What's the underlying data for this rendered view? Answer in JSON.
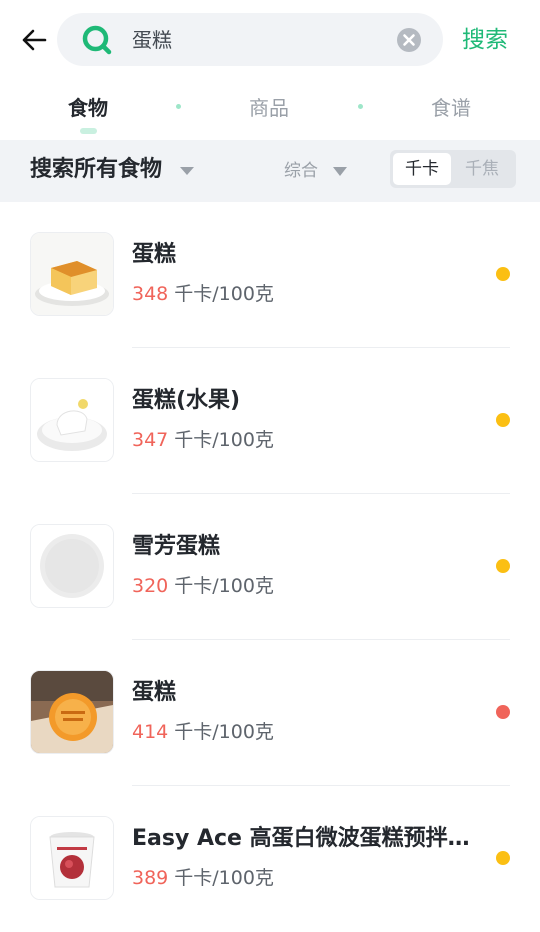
{
  "search": {
    "query": "蛋糕",
    "button_label": "搜索"
  },
  "tabs": [
    {
      "label": "食物",
      "active": true
    },
    {
      "label": "商品",
      "active": false
    },
    {
      "label": "食谱",
      "active": false
    }
  ],
  "filter": {
    "title": "搜索所有食物",
    "sort_label": "综合",
    "unit_options": [
      "千卡",
      "千焦"
    ],
    "selected_unit": "千卡"
  },
  "colors": {
    "accent": "#1fb977",
    "calorie": "#f0645a",
    "dot_medium": "#fbbf13",
    "dot_high": "#f0645a"
  },
  "foods": [
    {
      "name": "蛋糕",
      "calories": "348",
      "unit": "千卡/100克",
      "dot_color": "#fbbf13",
      "image": "sponge-cake"
    },
    {
      "name": "蛋糕(水果)",
      "calories": "347",
      "unit": "千卡/100克",
      "dot_color": "#fbbf13",
      "image": "fruit-cake"
    },
    {
      "name": "雪芳蛋糕",
      "calories": "320",
      "unit": "千卡/100克",
      "dot_color": "#fbbf13",
      "image": "placeholder"
    },
    {
      "name": "蛋糕",
      "calories": "414",
      "unit": "千卡/100克",
      "dot_color": "#f0645a",
      "image": "packaged-cake"
    },
    {
      "name": "Easy Ace 高蛋白微波蛋糕预拌…",
      "calories": "389",
      "unit": "千卡/100克",
      "dot_color": "#fbbf13",
      "image": "cake-mix-cup"
    }
  ]
}
